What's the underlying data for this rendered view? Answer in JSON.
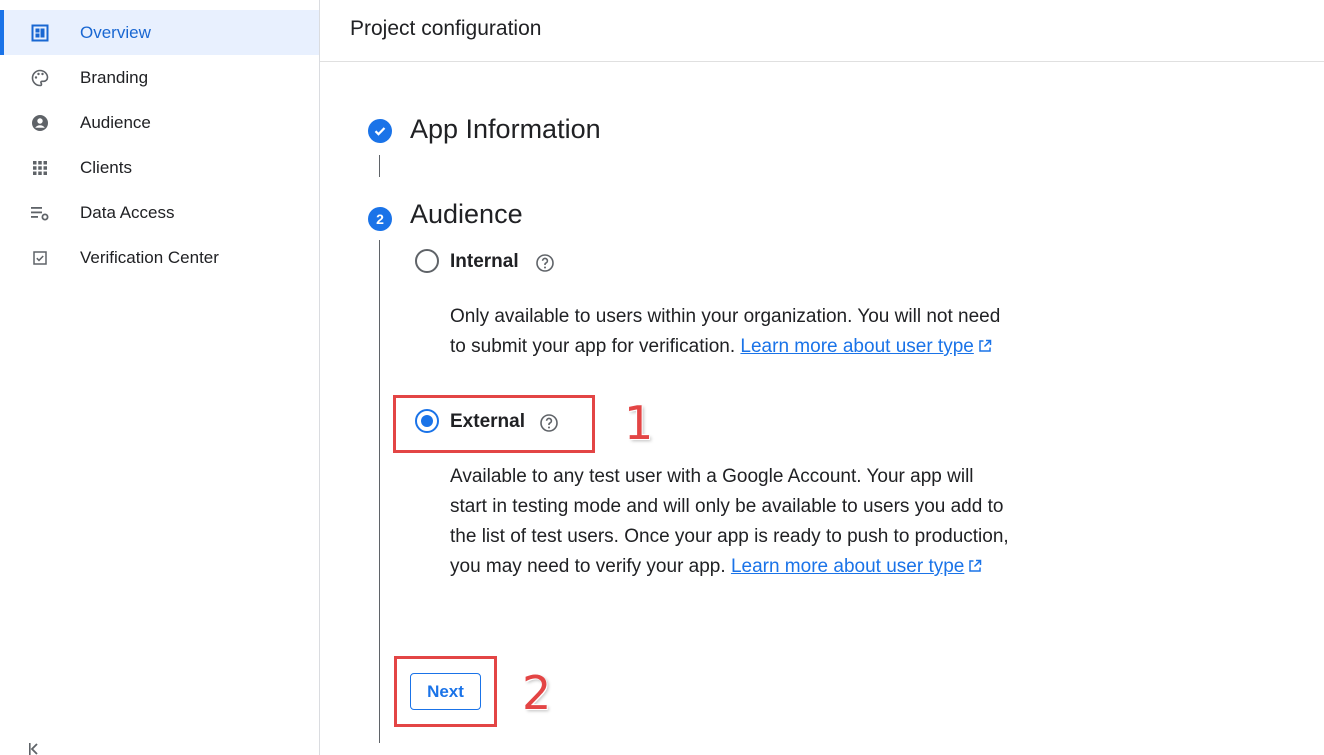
{
  "sidebar": {
    "items": [
      {
        "label": "Overview",
        "icon": "dashboard-icon",
        "active": true
      },
      {
        "label": "Branding",
        "icon": "palette-icon",
        "active": false
      },
      {
        "label": "Audience",
        "icon": "person-icon",
        "active": false
      },
      {
        "label": "Clients",
        "icon": "apps-grid-icon",
        "active": false
      },
      {
        "label": "Data Access",
        "icon": "list-settings-icon",
        "active": false
      },
      {
        "label": "Verification Center",
        "icon": "checkbox-icon",
        "active": false
      }
    ]
  },
  "header": {
    "title": "Project configuration"
  },
  "steps": {
    "step1": {
      "title": "App Information",
      "status": "complete"
    },
    "step2": {
      "number": "2",
      "title": "Audience",
      "status": "active"
    }
  },
  "audience": {
    "internal": {
      "label": "Internal",
      "selected": false,
      "description": "Only available to users within your organization. You will not need to submit your app for verification.",
      "link": "Learn more about user type"
    },
    "external": {
      "label": "External",
      "selected": true,
      "description": "Available to any test user with a Google Account. Your app will start in testing mode and will only be available to users you add to the list of test users. Once your app is ready to push to production, you may need to verify your app.",
      "link": "Learn more about user type"
    }
  },
  "next_button": {
    "label": "Next"
  },
  "annotations": {
    "marker1": "1",
    "marker2": "2"
  },
  "colors": {
    "accent": "#1a73e8",
    "annotation": "#e34545",
    "active_bg": "#e8f0fe"
  }
}
